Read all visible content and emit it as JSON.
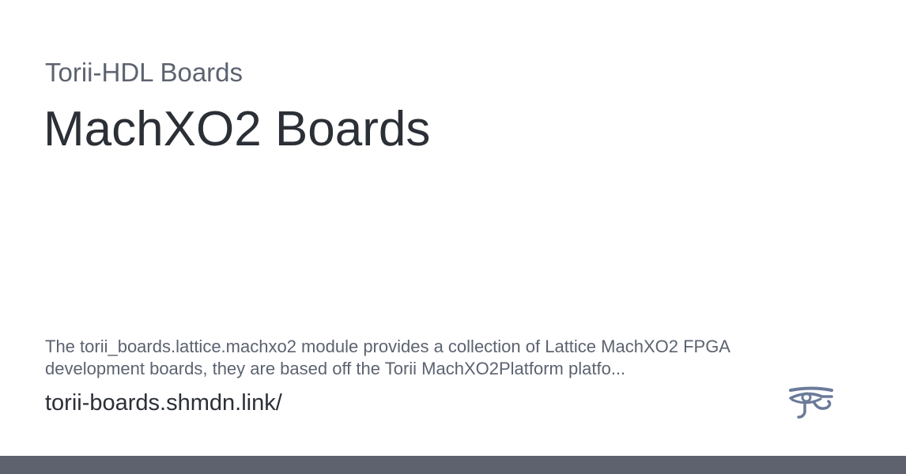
{
  "site_name": "Torii-HDL Boards",
  "title": "MachXO2 Boards",
  "description": "The torii_boards.lattice.machxo2 module provides a collection of Lattice MachXO2 FPGA development boards, they are based off the Torii MachXO2Platform platfo...",
  "url": "torii-boards.shmdn.link/",
  "logo": {
    "icon": "eye-of-horus-icon",
    "color": "#6b7a9a"
  },
  "colors": {
    "background": "#ffffff",
    "title": "#2b2f36",
    "muted_text": "#5c6370",
    "bottom_bar": "#5d626e"
  }
}
